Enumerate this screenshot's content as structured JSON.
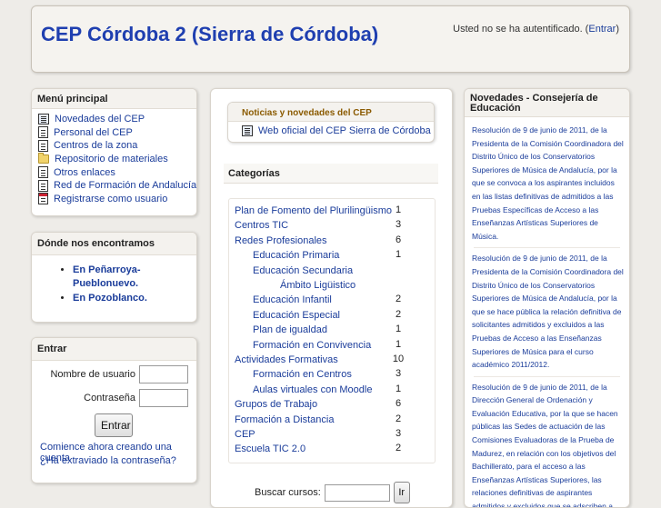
{
  "header": {
    "site_title": "CEP Córdoba 2 (Sierra de Córdoba)",
    "login_text": "Usted no se ha autentificado. (",
    "login_link": "Entrar",
    "login_close": ")"
  },
  "main_menu": {
    "title": "Menú principal",
    "items": [
      {
        "label": "Novedades del CEP",
        "icon": "screen-icon"
      },
      {
        "label": "Personal del CEP",
        "icon": "page-icon"
      },
      {
        "label": "Centros de la zona",
        "icon": "page-icon"
      },
      {
        "label": "Repositorio de materiales",
        "icon": "folder-icon"
      },
      {
        "label": "Otros enlaces",
        "icon": "page-icon"
      },
      {
        "label": "Red de Formación de Andalucía",
        "icon": "page-icon"
      },
      {
        "label": "Registrarse como usuario",
        "icon": "calendar-icon"
      }
    ]
  },
  "locations": {
    "title": "Dónde nos encontramos",
    "items": [
      "En Peñarroya-Pueblonuevo.",
      "En Pozoblanco."
    ]
  },
  "login_block": {
    "title": "Entrar",
    "username_label": "Nombre de usuario",
    "password_label": "Contraseña",
    "submit_label": "Entrar",
    "create_account": "Comience ahora creando una cuenta",
    "forgot_password": "¿Ha extraviado la contraseña?"
  },
  "center": {
    "news_title": "Noticias y novedades del CEP",
    "news_link": "Web oficial del CEP Sierra de Córdoba",
    "categories_title": "Categorías",
    "categories": [
      {
        "name": "Plan de Fomento del Plurilingüismo",
        "count": "1",
        "level": 0
      },
      {
        "name": "Centros TIC",
        "count": "3",
        "level": 0
      },
      {
        "name": "Redes Profesionales",
        "count": "6",
        "level": 0
      },
      {
        "name": "Educación Primaria",
        "count": "1",
        "level": 1
      },
      {
        "name": "Educación Secundaria",
        "count": "",
        "level": 1
      },
      {
        "name": "Ámbito Ligüistico",
        "count": "",
        "level": 2
      },
      {
        "name": "Educación Infantil",
        "count": "2",
        "level": 1
      },
      {
        "name": "Educación Especial",
        "count": "2",
        "level": 1
      },
      {
        "name": "Plan de igualdad",
        "count": "1",
        "level": 1
      },
      {
        "name": "Formación en Convivencia",
        "count": "1",
        "level": 1
      },
      {
        "name": "Actividades Formativas",
        "count": "10",
        "level": 0
      },
      {
        "name": "Formación en Centros",
        "count": "3",
        "level": 1
      },
      {
        "name": "Aulas virtuales con Moodle",
        "count": "1",
        "level": 1
      },
      {
        "name": "Grupos de Trabajo",
        "count": "6",
        "level": 0
      },
      {
        "name": "Formación a Distancia",
        "count": "2",
        "level": 0
      },
      {
        "name": "CEP",
        "count": "3",
        "level": 0
      },
      {
        "name": "Escuela TIC 2.0",
        "count": "2",
        "level": 0
      }
    ],
    "search_label": "Buscar cursos:",
    "search_button": "Ir"
  },
  "right": {
    "title": "Novedades - Consejería de Educación",
    "items": [
      "Resolución de 9 de junio de 2011, de la Presidenta de la Comisión Coordinadora del Distrito Único de los Conservatorios Superiores de Música de Andalucía, por la que se convoca a los aspirantes incluidos en las listas definitivas de admitidos a las Pruebas Específicas de Acceso a las Enseñanzas Artísticas Superiores de Música.",
      "Resolución de 9 de junio de 2011, de la Presidenta de la Comisión Coordinadora del Distrito Único de los Conservatorios Superiores de Música de Andalucía, por la que se hace pública la relación definitiva de solicitantes admitidos y excluidos a las Pruebas de Acceso a las Enseñanzas Superiores de Música para el curso académico 2011/2012.",
      "Resolución de 9 de junio de 2011, de la Dirección General de Ordenación y Evaluación Educativa, por la que se hacen públicas las Sedes de actuación de las Comisiones Evaluadoras de la Prueba de Madurez, en relación con los objetivos del Bachillerato, para el acceso a las Enseñanzas Artísticas Superiores, las relaciones definitivas de aspirantes admitidos y excluidos que se adscriben a"
    ]
  }
}
